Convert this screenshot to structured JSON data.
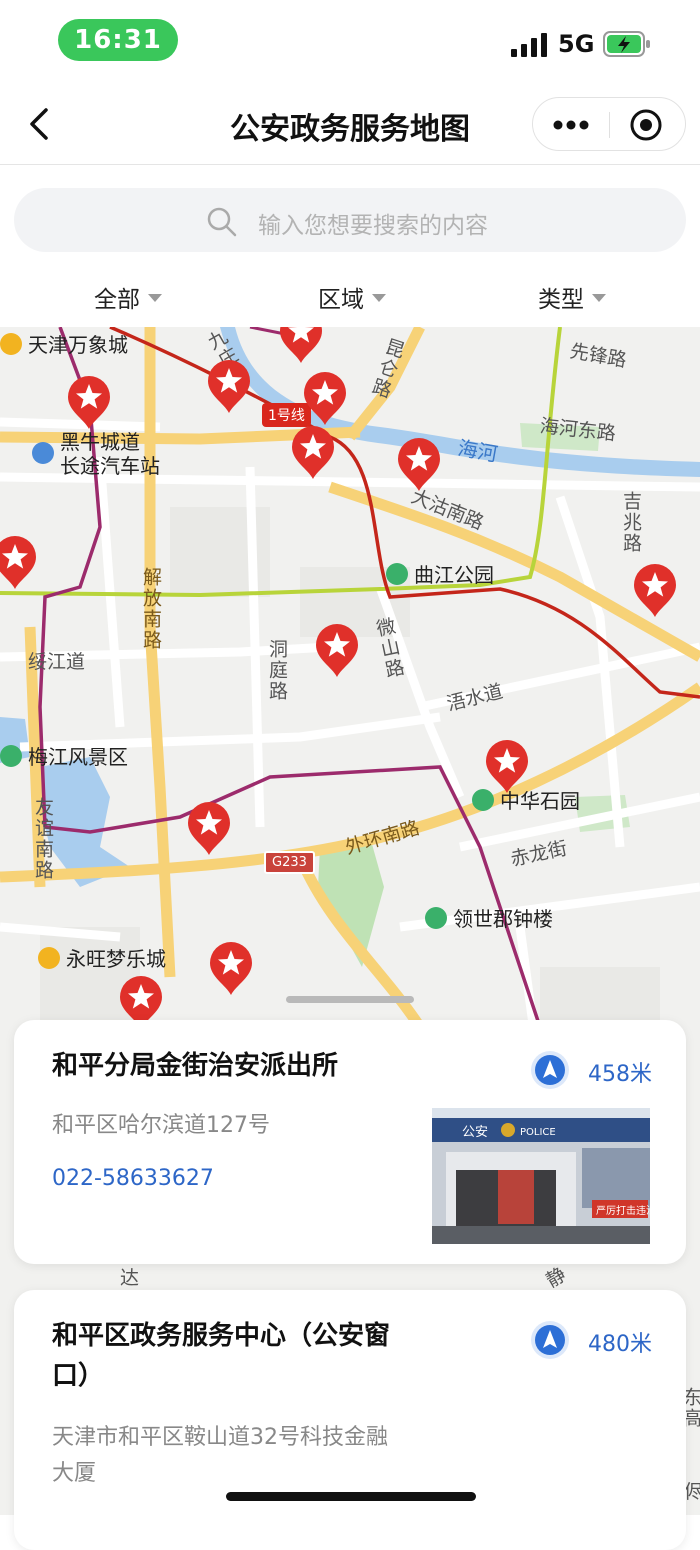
{
  "status_bar": {
    "time": "16:31",
    "network": "5G"
  },
  "nav": {
    "title": "公安政务服务地图"
  },
  "search": {
    "placeholder": "输入您想要搜索的内容"
  },
  "filters": [
    "全部",
    "区域",
    "类型"
  ],
  "map": {
    "pois": [
      {
        "label": "天津万象城",
        "color": "#f2b320"
      },
      {
        "label": "黑牛城道\n长途汽车站",
        "color": "#4a8ad8"
      },
      {
        "label": "曲江公园",
        "color": "#3ab06a"
      },
      {
        "label": "梅江风景区",
        "color": "#3ab06a"
      },
      {
        "label": "中华石园",
        "color": "#3ab06a"
      },
      {
        "label": "领世郡钟楼",
        "color": "#3ab06a"
      },
      {
        "label": "永旺梦乐城",
        "color": "#f2b320"
      }
    ],
    "roads": [
      "先锋路",
      "海河东路",
      "大沽南路",
      "吉兆路",
      "昆仑路",
      "解放南路",
      "绥江道",
      "洞庭路",
      "微山路",
      "浯水道",
      "友谊南路",
      "外环南路",
      "赤龙街",
      "九庄路",
      "达",
      "静",
      "东高",
      "侭"
    ],
    "river": "海河",
    "metro_badge": "1号线",
    "highway_badge": "G233"
  },
  "cards": [
    {
      "name": "和平分局金街治安派出所",
      "distance": "458米",
      "address": "和平区哈尔滨道127号",
      "phone": "022-58633627",
      "photo": {
        "sign_left": "公安",
        "sign_right": "POLICE",
        "banner": "严厉打击违法"
      }
    },
    {
      "name": "和平区政务服务中心（公安窗口）",
      "distance": "480米",
      "address": "天津市和平区鞍山道32号科技金融大厦"
    }
  ]
}
